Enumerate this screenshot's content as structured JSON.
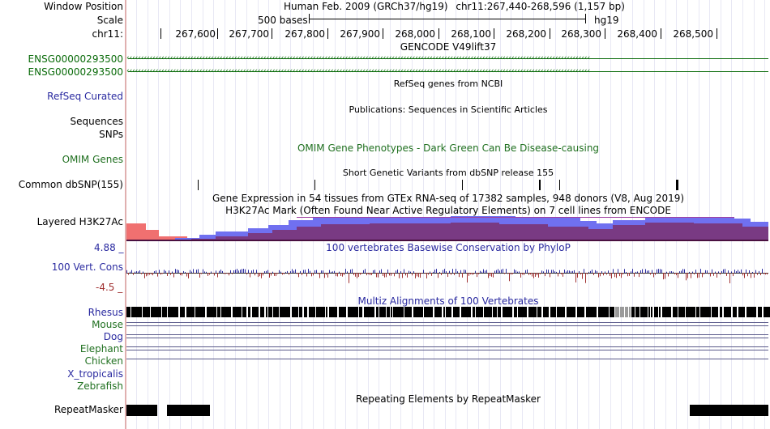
{
  "ruler": {
    "window_position_label": "Window Position",
    "scale_label": "Scale",
    "chrom_label": "chr11:",
    "assembly_title": "Human Feb. 2009 (GRCh37/hg19)",
    "position_text": "chr11:267,440-268,596 (1,157 bp)",
    "scale_text": "500 bases",
    "db_text": "hg19",
    "ticks": [
      "267,600",
      "267,700",
      "267,800",
      "267,900",
      "268,000",
      "268,100",
      "268,200",
      "268,300",
      "268,400",
      "268,500"
    ]
  },
  "gencode": {
    "title": "GENCODE V49lift37",
    "genes": [
      "ENSG00000293500",
      "ENSG00000293500"
    ]
  },
  "refseq": {
    "title": "RefSeq genes from NCBI",
    "label": "RefSeq Curated"
  },
  "publications": {
    "title": "Publications: Sequences in Scientific Articles",
    "label_sequences": "Sequences",
    "label_snps": "SNPs"
  },
  "omim": {
    "title": "OMIM Gene Phenotypes - Dark Green Can Be Disease-causing",
    "label": "OMIM Genes"
  },
  "dbsnp": {
    "title": "Short Genetic Variants from dbSNP release 155",
    "label": "Common dbSNP(155)"
  },
  "gtex": {
    "title": "Gene Expression in 54 tissues from GTEx RNA-seq of 17382 samples, 948 donors (V8, Aug 2019)"
  },
  "h3k27ac": {
    "title": "H3K27Ac Mark (Often Found Near Active Regulatory Elements) on 7 cell lines from ENCODE",
    "label": "Layered H3K27Ac"
  },
  "conservation": {
    "title": "100 vertebrates Basewise Conservation by PhyloP",
    "label": "100 Vert. Cons",
    "max_label": "4.88 _",
    "min_label": "-4.5 _"
  },
  "multiz": {
    "title": "Multiz Alignments of 100 Vertebrates",
    "species": [
      "Rhesus",
      "Mouse",
      "Dog",
      "Elephant",
      "Chicken",
      "X_tropicalis",
      "Zebrafish"
    ]
  },
  "repeatmasker": {
    "title": "Repeating Elements by RepeatMasker",
    "label": "RepeatMasker"
  },
  "colors": {
    "gene_green": "#0a6b0a",
    "track_blue": "#2a2aa0",
    "omim_green": "#207020",
    "h3k_red": "#f07070",
    "h3k_blue": "#7070f0",
    "h3k_purple": "#7a3070"
  }
}
